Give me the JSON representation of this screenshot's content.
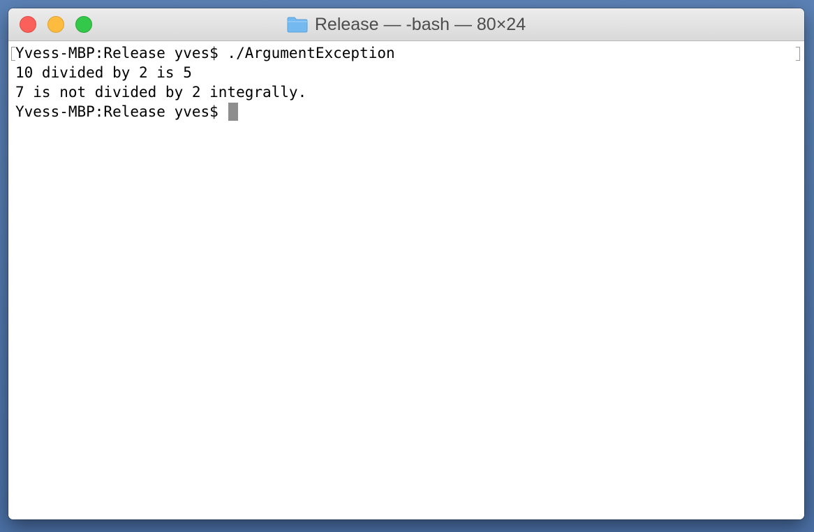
{
  "window": {
    "title": "Release — -bash — 80×24",
    "title_icon": "folder-icon",
    "buttons": {
      "close_icon": "close-icon",
      "minimize_icon": "minimize-icon",
      "zoom_icon": "zoom-icon"
    }
  },
  "terminal": {
    "lines": [
      "Yvess-MBP:Release yves$ ./ArgumentException",
      "10 divided by 2 is 5",
      "7 is not divided by 2 integrally.",
      "Yvess-MBP:Release yves$ "
    ],
    "cursor_color": "#8e8e8e"
  },
  "colors": {
    "close": "#fc605b",
    "minimize": "#fdbc40",
    "zoom": "#34c84a",
    "folder": "#6fb6f0"
  }
}
